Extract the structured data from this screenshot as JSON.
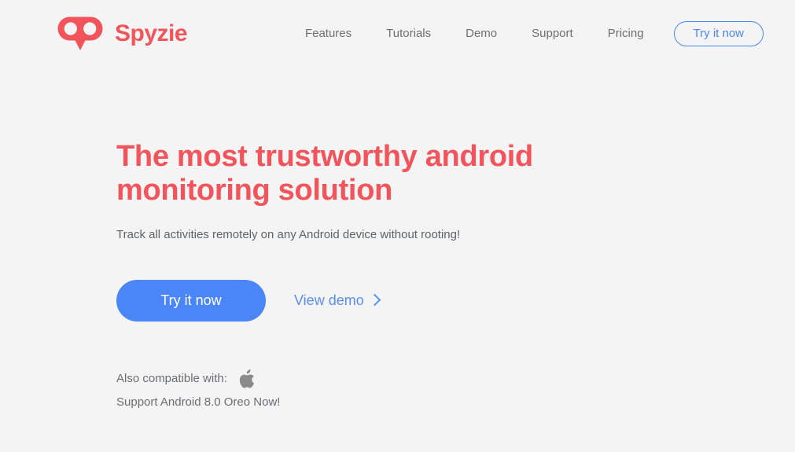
{
  "brand": {
    "name": "Spyzie",
    "logo_icon": "spyzie-owl-logo-icon",
    "accent_color": "#f2545b"
  },
  "header": {
    "nav": [
      {
        "label": "Features"
      },
      {
        "label": "Tutorials"
      },
      {
        "label": "Demo"
      },
      {
        "label": "Support"
      },
      {
        "label": "Pricing"
      }
    ],
    "cta_label": "Try it now",
    "cta_color": "#4a86f7"
  },
  "hero": {
    "title_line1": "The most trustworthy android",
    "title_line2": "monitoring solution",
    "subtitle": "Track all activities remotely on any Android device without rooting!",
    "primary_button_label": "Try it now",
    "secondary_link_label": "View demo",
    "secondary_link_icon": "chevron-right-icon"
  },
  "compatibility": {
    "label": "Also compatible with:",
    "platform_icon": "apple-logo-icon",
    "note": "Support Android 8.0 Oreo Now!"
  },
  "theme": {
    "background": "#f4f4f4",
    "text_muted": "#6a6e73",
    "blue": "#4a86f7",
    "red": "#f2545b"
  }
}
